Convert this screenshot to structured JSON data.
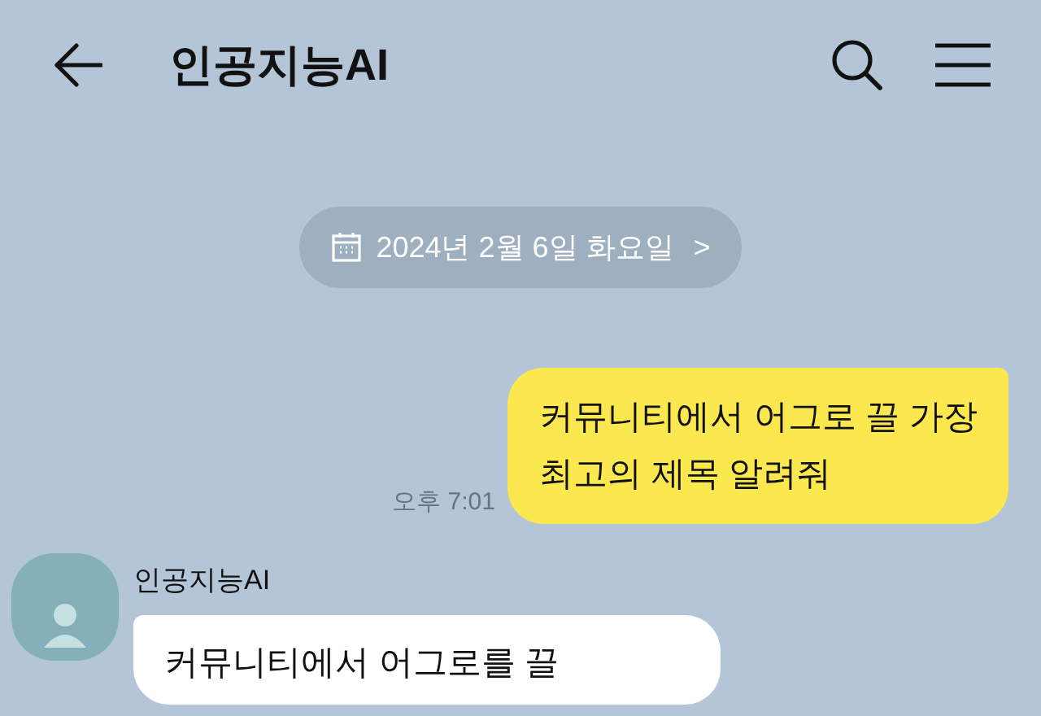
{
  "header": {
    "title": "인공지능AI"
  },
  "date_divider": {
    "label": "2024년 2월 6일 화요일",
    "arrow": ">"
  },
  "messages": [
    {
      "kind": "sent",
      "lines": [
        "커뮤니티에서 어그로 끌 가장",
        "최고의 제목 알려줘"
      ],
      "time": "오후 7:01"
    },
    {
      "kind": "received",
      "sender": "인공지능AI",
      "lines": [
        "커뮤니티에서 어그로를 끌"
      ]
    }
  ]
}
